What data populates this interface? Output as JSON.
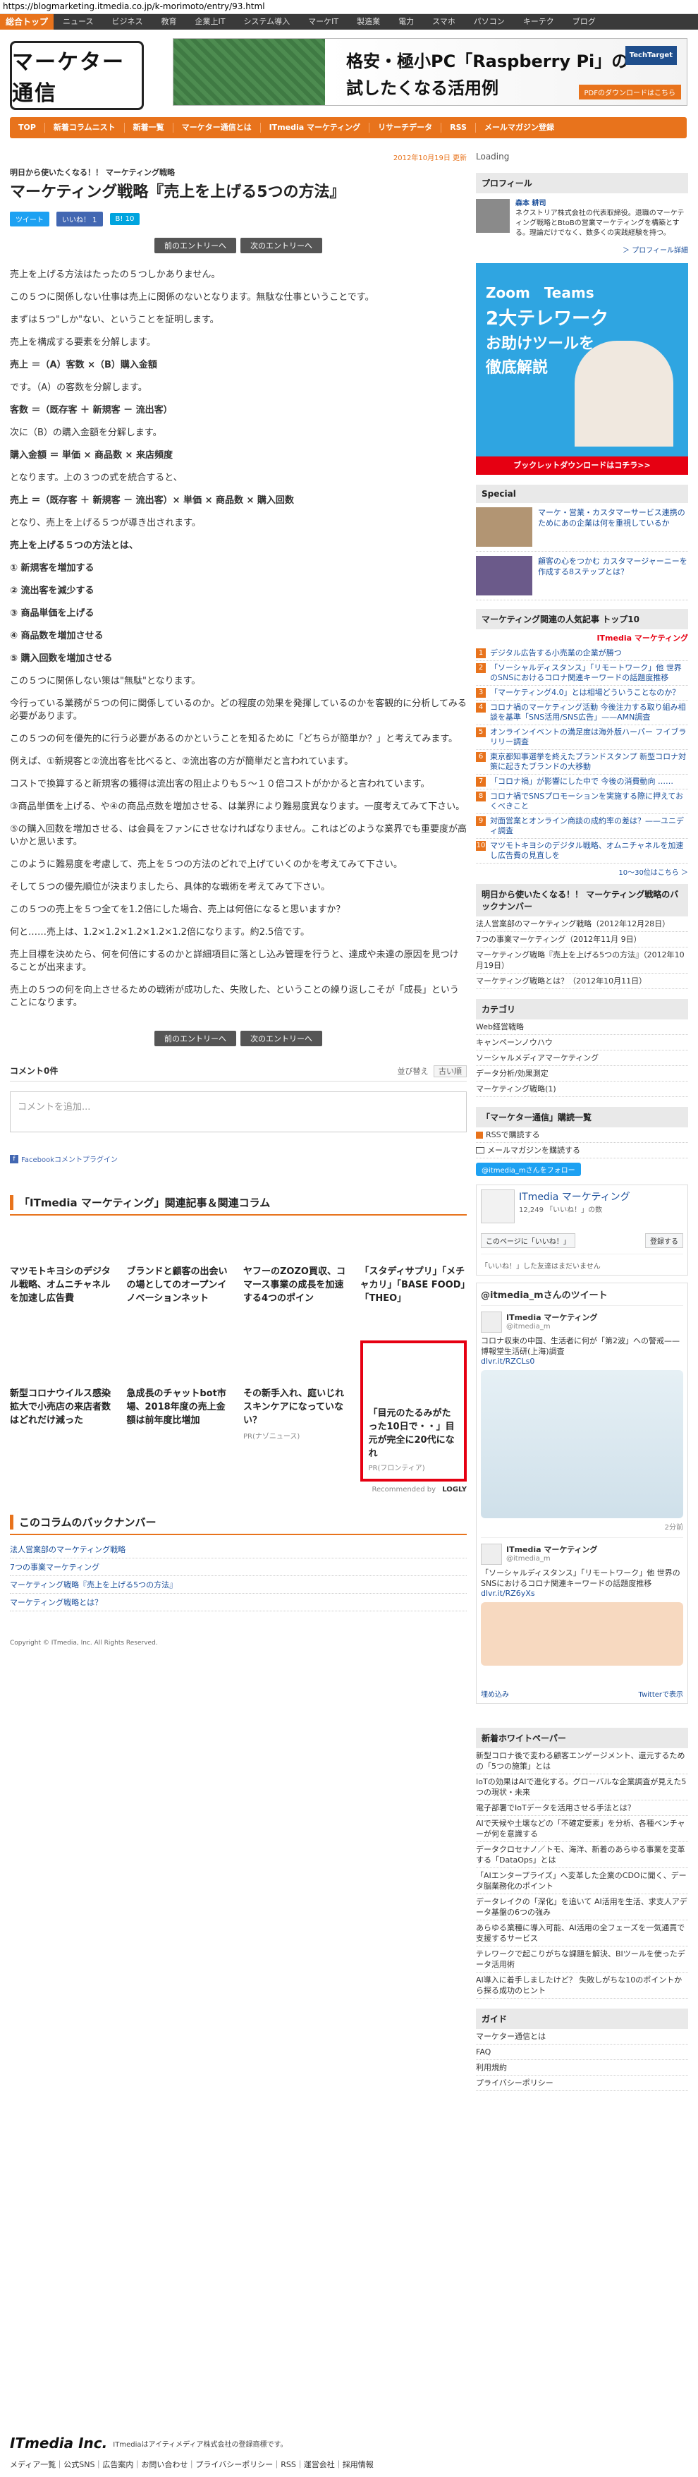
{
  "url": "https://blogmarketing.itmedia.co.jp/k-morimoto/entry/93.html",
  "topnav": {
    "home": "総合トップ",
    "items": [
      "ニュース",
      "ビジネス",
      "教育",
      "企業上IT",
      "システム導入",
      "マーケIT",
      "製造業",
      "電力",
      "スマホ",
      "パソコン",
      "キーテク",
      "ブログ"
    ]
  },
  "logo": {
    "text": "マーケター通信"
  },
  "banner": {
    "title1": "格安・極小PC「Raspberry Pi」の",
    "title2": "試したくなる活用例",
    "brand": "TechTarget",
    "cta": "PDFのダウンロードはこちら"
  },
  "orangenav": [
    "TOP",
    "新着コラムニスト",
    "新着一覧",
    "マーケター通信とは",
    "ITmedia マーケティング",
    "リサーチデータ",
    "RSS",
    "メールマガジン登録"
  ],
  "article": {
    "date": "2012年10月19日 更新",
    "category": "明日から使いたくなる！！ マーケティング戦略",
    "title": "マーケティング戦略『売上を上げる5つの方法』",
    "tweet": "ツイート",
    "like": "いいね！ 1",
    "bm": "B! 10",
    "prev": "前のエントリーへ",
    "next": "次のエントリーへ",
    "lines": [
      "売上を上げる方法はたったの５つしかありません。",
      "この５つに関係しない仕事は売上に関係のないとなります。無駄な仕事ということです。",
      "まずは５つ\"しか\"ない、ということを証明します。",
      "売上を構成する要素を分解します。",
      "売上 ＝（A）客数 ×（B）購入金額",
      "です。（A）の客数を分解します。",
      "客数 ＝（既存客 ＋ 新規客 － 流出客）",
      "次に（B）の購入金額を分解します。",
      "購入金額 ＝ 単価 × 商品数 × 来店頻度",
      "となります。上の３つの式を統合すると、",
      "売上 ＝（既存客 ＋ 新規客 － 流出客）× 単価 × 商品数 × 購入回数",
      "となり、売上を上げる５つが導き出されます。",
      "売上を上げる５つの方法とは、",
      "① 新規客を増加する",
      "② 流出客を減少する",
      "③ 商品単価を上げる",
      "④ 商品数を増加させる",
      "⑤ 購入回数を増加させる",
      "この５つに関係しない策は\"無駄\"となります。",
      "今行っている業務が５つの何に関係しているのか。どの程度の効果を発揮しているのかを客観的に分析してみる必要があります。",
      "この５つの何を優先的に行う必要があるのかということを知るために「どちらが簡単か？」と考えてみます。",
      "例えば、①新規客と②流出客を比べると、②流出客の方が簡単だと言われています。",
      "コストで換算すると新規客の獲得は流出客の阻止よりも５～１０倍コストがかかると言われています。",
      "③商品単価を上げる、や④の商品点数を増加させる、は業界により難易度異なります。一度考えてみて下さい。",
      "⑤の購入回数を増加させる、は会員をファンにさせなければなりません。これはどのような業界でも重要度が高いかと思います。",
      "このように難易度を考慮して、売上を５つの方法のどれで上げていくのかを考えてみて下さい。",
      "そして５つの優先順位が決まりましたら、具体的な戦術を考えてみて下さい。",
      "この５つの売上を５つ全てを1.2倍にした場合、売上は何倍になると思いますか？",
      "何と……売上は、1.2×1.2×1.2×1.2×1.2倍になります。約2.5倍です。",
      "売上目標を決めたら、何を何倍にするのかと詳細項目に落とし込み管理を行うと、達成や未達の原因を見つけることが出来ます。",
      "売上の５つの何を向上させるための戦術が成功した、失敗した、ということの繰り返しこそが「成長」ということになります。"
    ]
  },
  "comments": {
    "count": "コメント0件",
    "sort_label": "並び替え",
    "sort_value": "古い順",
    "placeholder": "コメントを追加...",
    "plugin": "Facebookコメントプラグイン"
  },
  "related": {
    "title": "「ITmedia マーケティング」関連記事＆関連コラム",
    "items": [
      "マツモトキヨシのデジタル戦略、オムニチャネルを加速し広告費",
      "ブランドと顧客の出会いの場としてのオープンイノベーションネット",
      "ヤフーのZOZO買収、コマース事業の成長を加速する4つのポイン",
      "「スタディサプリ」「メチャカリ」「BASE FOOD」「THEO」",
      "新型コロナウイルス感染拡大で小売店の来店者数はどれだけ減った",
      "急成長のチャットbot市場、2018年度の売上金額は前年度比増加",
      "その新手入れ、庭いじれスキンケアになっていない？"
    ],
    "pr_item": "「目元のたるみがたった10日で・・」目元が完全に20代になれ",
    "pr_label": "PR(フロンティア)",
    "pr_nav": "PR(ナゾニュース)",
    "recommended": "Recommended by",
    "logly": "LOGLY"
  },
  "backnumber": {
    "title": "このコラムのバックナンバー",
    "items": [
      "法人営業部のマーケティング戦略",
      "7つの事業マーケティング",
      "マーケティング戦略『売上を上げる5つの方法』",
      "マーケティング戦略とは？"
    ]
  },
  "copyright": "Copyright © ITmedia, Inc. All Rights Reserved.",
  "side": {
    "loading": "Loading",
    "profile_title": "プロフィール",
    "profile_name": "森本 耕司",
    "profile_text": "ネクストリア株式会社の代表取締役。退職のマーケティング戦略とBtoBの営業マーケティングを構築とする。理論だけでなく、数多くの実践経験を持つ。",
    "profile_more": "＞ プロフィール詳細",
    "ad_title1": "Zoom　Teams",
    "ad_title2": "2大テレワーク",
    "ad_title3": "お助けツールを",
    "ad_title4": "徹底解説",
    "ad_cta": "ブックレットダウンロードはコチラ>>",
    "special_title": "Special",
    "special_items": [
      "マーケ・営業・カスタマーサービス連携のためにあの企業は何を重視しているか",
      "顧客の心をつかむ カスタマージャーニーを作成する8ステップとは？"
    ],
    "ranking_title": "マーケティング関連の人気記事 トップ10",
    "ranking_logo": "ITmedia マーケティング",
    "ranking": [
      "デジタル広告する小売業の企業が勝つ",
      "「ソーシャルディスタンス」「リモートワーク」他 世界のSNSにおけるコロナ関連キーワードの話題度推移",
      "「マーケティング4.0」とは相場どういうことなのか？",
      "コロナ禍のマーケティング活動 今後注力する取り組み相談を基準「SNS活用/SNS広告」——AMN調査",
      "オンラインイベントの満足度は海外版ハーパー フイブラリリー調査",
      "東京都知事選挙を終えたブランドスタンプ 新型コロナ対策に起きたブランドの大移動",
      "「コロナ禍」が影響にした中で 今後の消費動向 ……",
      "コロナ禍でSNSプロモーションを実施する際に押えておくべきこと",
      "対面営業とオンライン商談の成約率の差は？——ユニディ調査",
      "マツモトキヨシのデジタル戦略、オムニチャネルを加速し広告費の見直しを"
    ],
    "ranking_more": "10～30位はこちら ＞",
    "series_title": "明日から使いたくなる！！ マーケティング戦略のバックナンバー",
    "series": [
      "法人営業部のマーケティング戦略（2012年12月28日）",
      "7つの事業マーケティング（2012年11月 9日）",
      "マーケティング戦略『売上を上げる5つの方法』（2012年10月19日）",
      "マーケティング戦略とは？（2012年10月11日）"
    ],
    "category_title": "カテゴリ",
    "categories": [
      "Web経営戦略",
      "キャンペーンノウハウ",
      "ソーシャルメディアマーケティング",
      "データ分析/効果測定",
      "マーケティング戦略(1)"
    ],
    "subscribe_title": "「マーケター通信」購読一覧",
    "subscribe": [
      "RSSで購読する",
      "メールマガジンを購読する"
    ],
    "twitter_follow": "@itmedia_mさんをフォロー",
    "fb_name": "ITmedia マーケティング",
    "fb_likes": "12,249 「いいね！」の数",
    "fb_like_btn": "このページに「いいね！」",
    "fb_register": "登録する",
    "fb_friends": "「いいね！」した友達はまだいません",
    "tweets_header": "@itmedia_mさんのツイート",
    "tweet1_name": "ITmedia マーケティング",
    "tweet1_handle": "@itmedia_m",
    "tweet1_text": "コロナ収束の中国、生活者に何が「第2波」への警戒——博報堂生活研(上海)調査",
    "tweet1_link": "dlvr.it/RZCLs0",
    "tweet_time": "2分前",
    "tweet2_name": "ITmedia マーケティング",
    "tweet2_handle": "@itmedia_m",
    "tweet2_text": "「ソーシャルディスタンス」「リモートワーク」他 世界のSNSにおけるコロナ関連キーワードの話題度推移",
    "tweet2_link": "dlvr.it/RZ6yXs",
    "tweets_embed": "埋め込み",
    "tweets_view": "Twitterで表示",
    "wp_title": "新着ホワイトペーパー",
    "wp": [
      "新型コロナ後で変わる顧客エンゲージメント、還元するための「5つの施策」とは",
      "IoTの効果はAIで進化する。グローバルな企業調査が見えた5つの現状・未来",
      "電子部署でIoTデータを活用させる手法とは？",
      "AIで天候や土壌などの「不確定要素」を分析、各種ベンチャーが何を意識する",
      "データクロセナノ／トモ、海洋、新着のあらゆる事業を変革する「DataOps」とは",
      "「AIエンタープライズ」へ変革した企業のCDOに聞く、データ脳業務化のポイント",
      "データレイクの「深化」を追いて AI活用を生活、求支人アデータ基盤の6つの強み",
      "あらゆる業種に導入可能、AI活用の全フェーズを一気通貫で支援するサービス",
      "テレワークで起こりがちな課題を解決、BIツールを使ったデータ活用術",
      "AI導入に着手しましたけど？ 失敗しがちな10のポイントから探る成功のヒント"
    ],
    "guide_title": "ガイド",
    "guide": [
      "マーケター通信とは",
      "FAQ",
      "利用規約",
      "プライバシーポリシー"
    ]
  },
  "footer": {
    "company": "ITmedia Inc.",
    "desc": "ITmediaはアイティメディア株式会社の登録商標です。",
    "links": "メディア一覧｜公式SNS｜広告案内｜お問い合わせ｜プライバシーポリシー｜RSS｜運営会社｜採用情報"
  },
  "colors": {
    "accent": "#e8731c",
    "nav_dark": "#3a3a3a",
    "red_border": "#e60012"
  }
}
